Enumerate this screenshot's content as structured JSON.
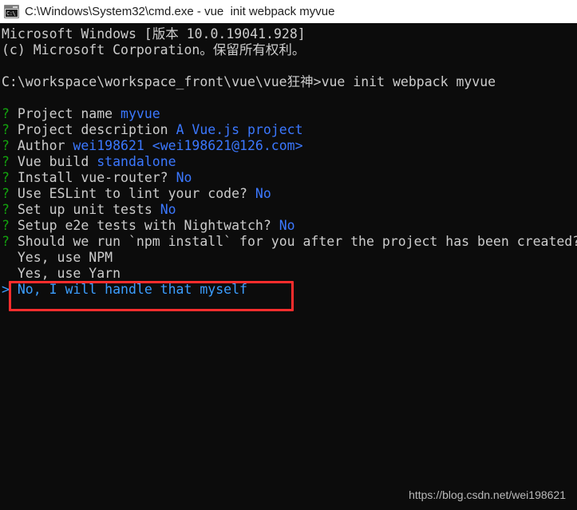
{
  "window": {
    "title": "C:\\Windows\\System32\\cmd.exe - vue  init webpack myvue",
    "icon_name": "cmd-exe-icon",
    "icon_glyph": "C:\\",
    "titlebar_bg": "#ffffff",
    "console_bg": "#0c0c0c"
  },
  "colors": {
    "text": "#cccccc",
    "prompt_marker": "#13a10e",
    "answer": "#3b78ff",
    "selected_option": "#3b9eff",
    "annotation": "#ff2d2d",
    "watermark": "#b9b9b9"
  },
  "console": {
    "banner": [
      "Microsoft Windows [版本 10.0.19041.928]",
      "(c) Microsoft Corporation。保留所有权利。"
    ],
    "prompt_path": "C:\\workspace\\workspace_front\\vue\\vue狂神>",
    "command": "vue init webpack myvue",
    "questions": [
      {
        "marker": "?",
        "label": "Project name ",
        "answer": "myvue"
      },
      {
        "marker": "?",
        "label": "Project description ",
        "answer": "A Vue.js project"
      },
      {
        "marker": "?",
        "label": "Author ",
        "answer": "wei198621 <wei198621@126.com>"
      },
      {
        "marker": "?",
        "label": "Vue build ",
        "answer": "standalone"
      },
      {
        "marker": "?",
        "label": "Install vue-router? ",
        "answer": "No"
      },
      {
        "marker": "?",
        "label": "Use ESLint to lint your code? ",
        "answer": "No"
      },
      {
        "marker": "?",
        "label": "Set up unit tests ",
        "answer": "No"
      },
      {
        "marker": "?",
        "label": "Setup e2e tests with Nightwatch? ",
        "answer": "No"
      }
    ],
    "active_question": {
      "marker": "?",
      "text": "Should we run `npm install` for you after the project has been created?"
    },
    "options": [
      {
        "cursor": "  ",
        "label": "Yes, use NPM",
        "selected": false
      },
      {
        "cursor": "  ",
        "label": "Yes, use Yarn",
        "selected": false
      },
      {
        "cursor": "> ",
        "label": "No, I will handle that myself",
        "selected": true
      }
    ]
  },
  "annotation": {
    "name": "red-highlight-box",
    "target": "No, I will handle that myself"
  },
  "watermark": {
    "text": "https://blog.csdn.net/wei198621"
  }
}
